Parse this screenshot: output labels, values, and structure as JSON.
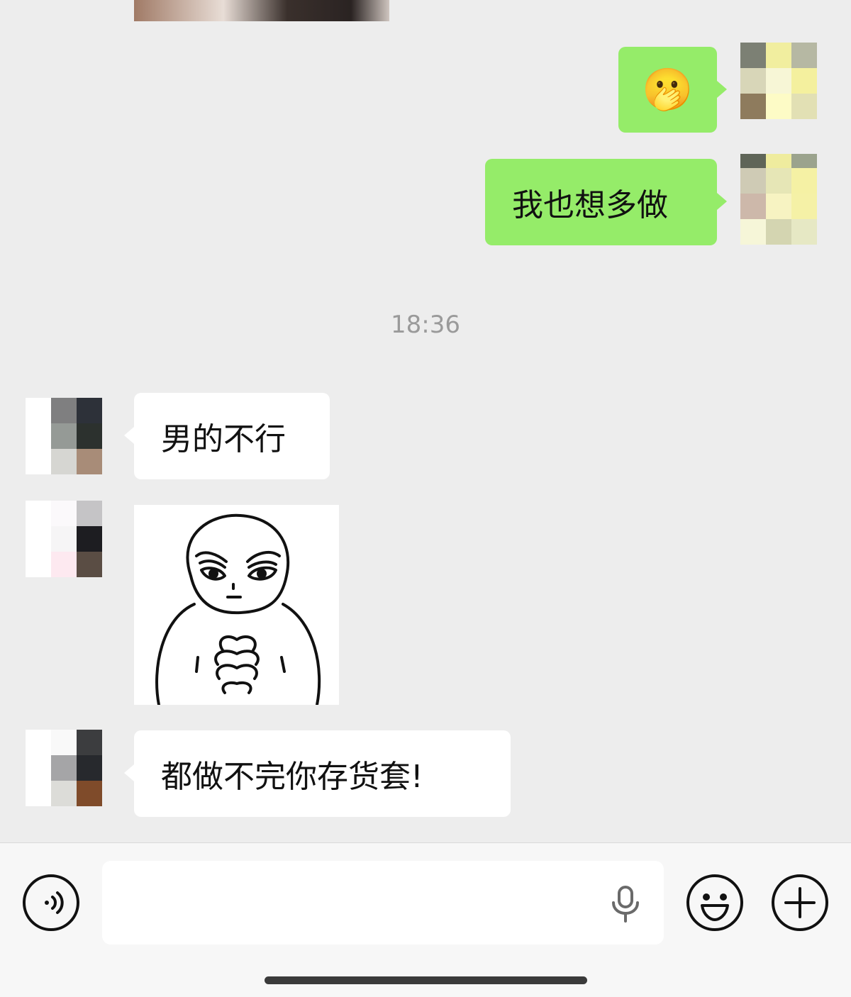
{
  "messages": {
    "sent_1": {
      "emoji": "🫢"
    },
    "sent_2": {
      "text": "我也想多做"
    },
    "timestamp": "18:36",
    "received_1": {
      "text": "男的不行"
    },
    "received_3": {
      "text": "都做不完你存货套!"
    }
  },
  "colors": {
    "background": "#ededed",
    "sent_bubble": "#95ec69",
    "received_bubble": "#ffffff",
    "timestamp_text": "#9a9a9a"
  },
  "input_bar": {
    "voice_toggle_icon": "voice-wave-icon",
    "mic_icon": "microphone-icon",
    "emoji_icon": "smiley-icon",
    "more_icon": "plus-icon",
    "text_value": ""
  }
}
